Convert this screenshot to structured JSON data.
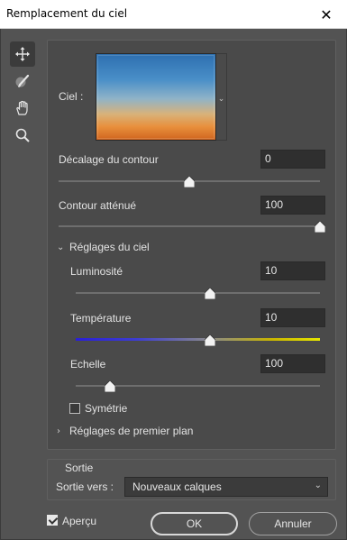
{
  "window": {
    "title": "Remplacement du ciel",
    "close_glyph": "✕"
  },
  "tools": [
    {
      "name": "move-tool",
      "icon": "move-icon",
      "active": true
    },
    {
      "name": "sky-brush-tool",
      "icon": "sky-brush-icon",
      "active": false
    },
    {
      "name": "hand-tool",
      "icon": "hand-icon",
      "active": false
    },
    {
      "name": "zoom-tool",
      "icon": "zoom-icon",
      "active": false
    }
  ],
  "sky": {
    "label": "Ciel :",
    "dropdown_glyph": "⌄"
  },
  "edge_shift": {
    "label": "Décalage du contour",
    "value": "0",
    "level": 0.5
  },
  "fade_edge": {
    "label": "Contour atténué",
    "value": "100",
    "level": 1.0
  },
  "sky_adjustments": {
    "header": "Réglages du ciel",
    "expanded": true,
    "brightness": {
      "label": "Luminosité",
      "value": "10",
      "level": 0.55
    },
    "temperature": {
      "label": "Température",
      "value": "10",
      "level": 0.55
    },
    "scale": {
      "label": "Echelle",
      "value": "100",
      "level": 0.14
    },
    "flip": {
      "label": "Symétrie",
      "checked": false
    }
  },
  "foreground_adjustments": {
    "header": "Réglages de premier plan",
    "expanded": false
  },
  "output": {
    "group_label": "Sortie",
    "to_label": "Sortie vers :",
    "selected": "Nouveaux calques",
    "dropdown_glyph": "⌄"
  },
  "preview": {
    "label": "Aperçu",
    "checked": true
  },
  "buttons": {
    "ok": "OK",
    "cancel": "Annuler"
  },
  "colors": {
    "background": "#535353",
    "panel": "#4a4a4a",
    "field": "#2f2f2f"
  }
}
